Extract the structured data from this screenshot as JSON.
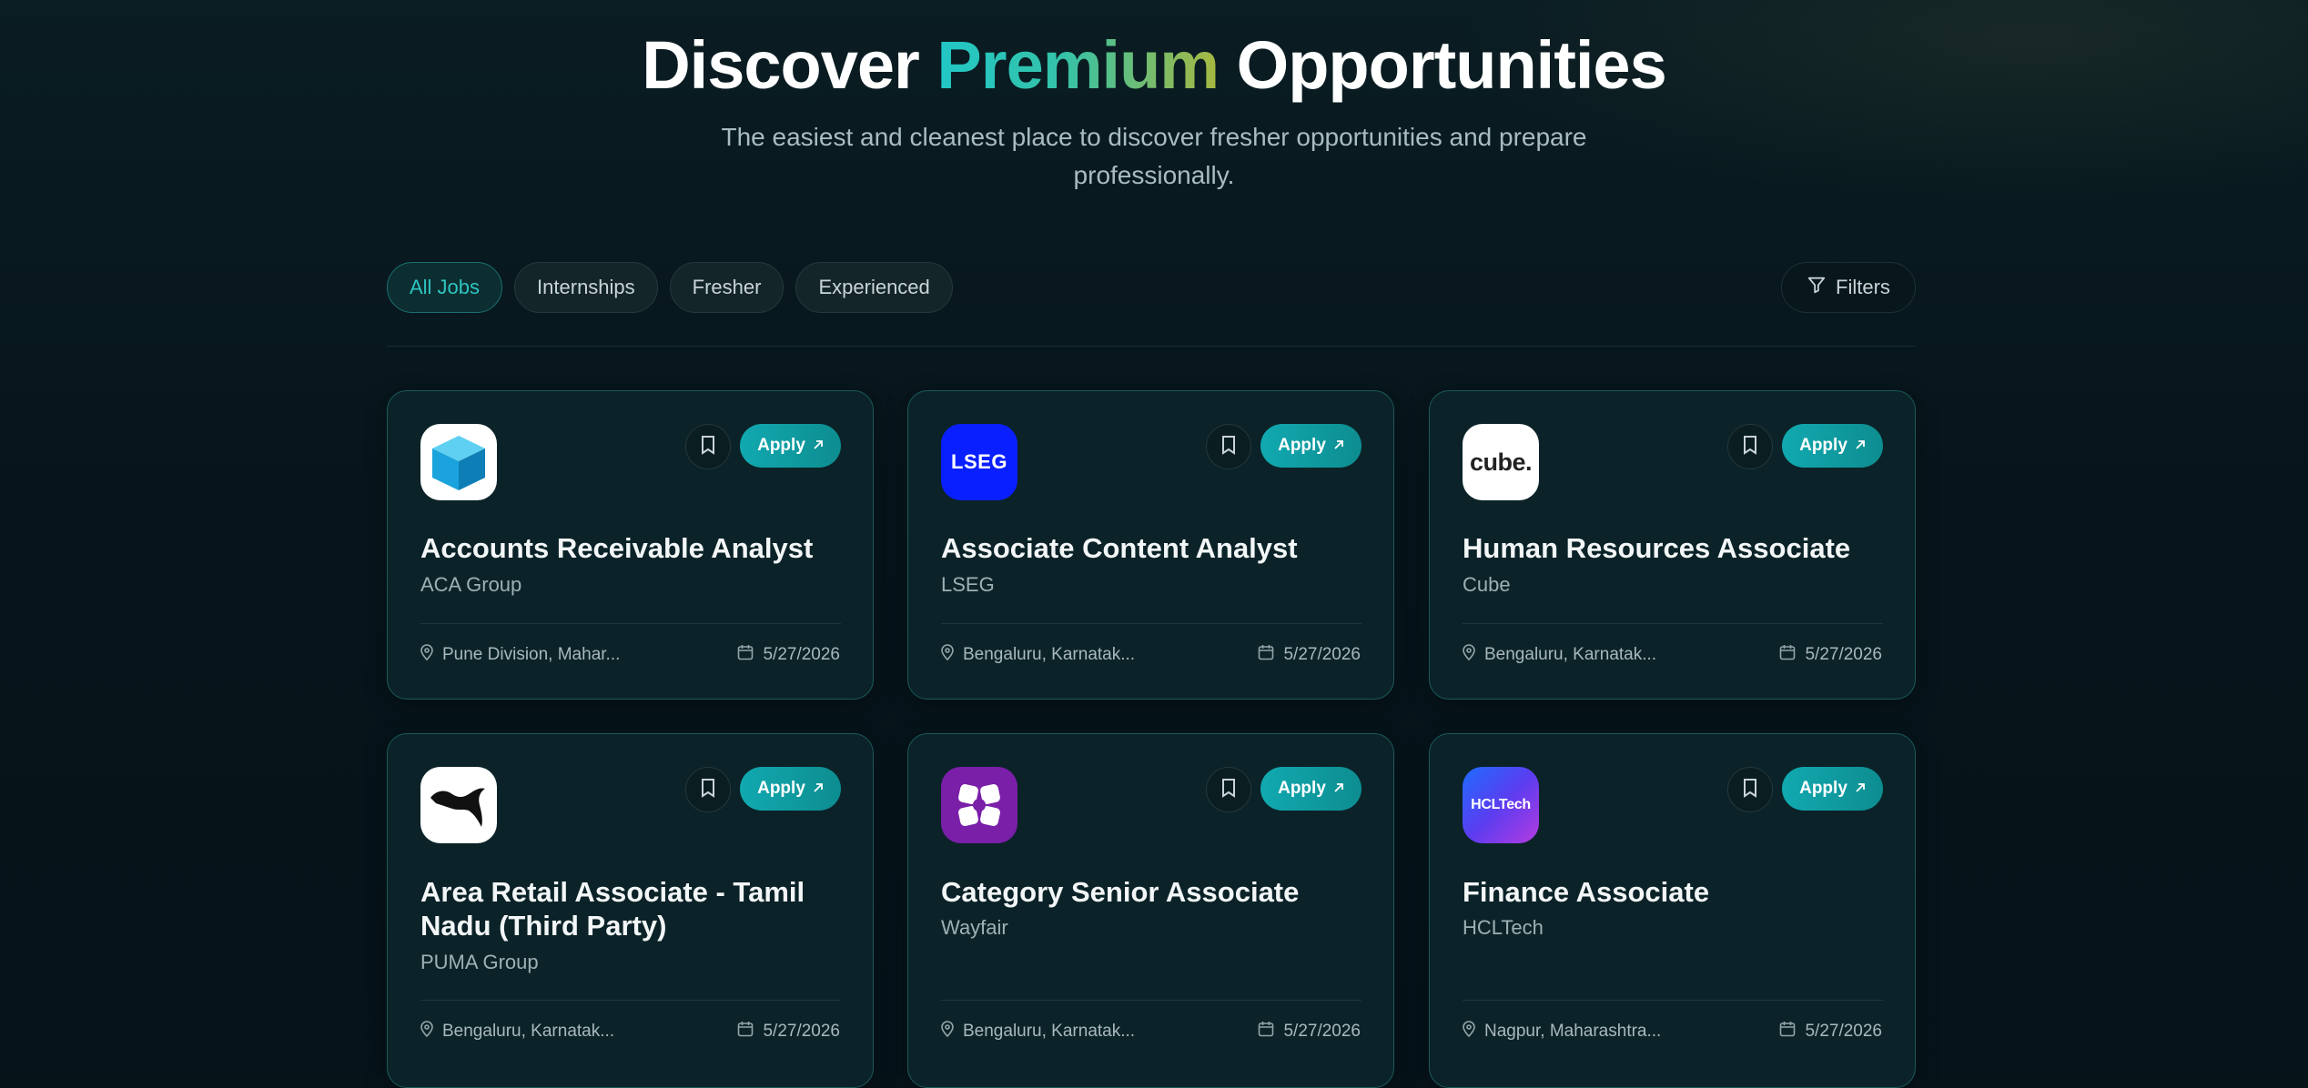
{
  "hero": {
    "title_before": "Discover",
    "title_highlight": "Premium",
    "title_after": "Opportunities",
    "subtitle": "The easiest and cleanest place to discover fresher opportunities and prepare professionally."
  },
  "tabs": [
    "All Jobs",
    "Internships",
    "Fresher",
    "Experienced"
  ],
  "active_tab": "All Jobs",
  "filters_label": "Filters",
  "apply_label": "Apply",
  "jobs": [
    {
      "title": "Accounts Receivable Analyst",
      "company": "ACA Group",
      "location": "Pune Division, Mahar...",
      "date": "5/27/2026",
      "logo": "blue-cube-logo"
    },
    {
      "title": "Associate Content Analyst",
      "company": "LSEG",
      "location": "Bengaluru, Karnatak...",
      "date": "5/27/2026",
      "logo": "lseg-logo",
      "logo_text": "LSEG"
    },
    {
      "title": "Human Resources Associate",
      "company": "Cube",
      "location": "Bengaluru, Karnatak...",
      "date": "5/27/2026",
      "logo": "cube-logo",
      "logo_text": "cube."
    },
    {
      "title": "Area Retail Associate - Tamil Nadu (Third Party)",
      "company": "PUMA Group",
      "location": "Bengaluru, Karnatak...",
      "date": "5/27/2026",
      "logo": "puma-logo"
    },
    {
      "title": "Category Senior Associate",
      "company": "Wayfair",
      "location": "Bengaluru, Karnatak...",
      "date": "5/27/2026",
      "logo": "wayfair-logo"
    },
    {
      "title": "Finance Associate",
      "company": "HCLTech",
      "location": "Nagpur, Maharashtra...",
      "date": "5/27/2026",
      "logo": "hcltech-logo",
      "logo_text": "HCLTech"
    }
  ],
  "colors": {
    "accent": "#11a9b0",
    "background": "#06141a",
    "card": "#0b2328",
    "card_border": "#1b5a5a"
  }
}
